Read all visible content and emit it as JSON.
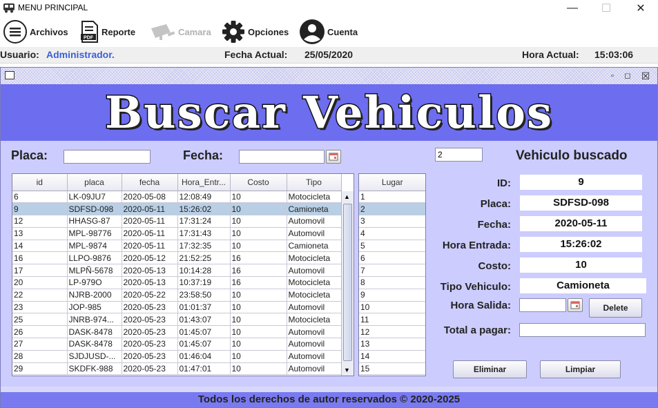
{
  "window": {
    "title": "MENU PRINCIPAL",
    "minimize": "—",
    "maximize": "☐",
    "close": "✕"
  },
  "toolbar": {
    "archivos": "Archivos",
    "reporte": "Reporte",
    "camara": "Camara",
    "opciones": "Opciones",
    "cuenta": "Cuenta"
  },
  "status": {
    "user_label": "Usuario:",
    "user_value": "Administrador.",
    "date_label": "Fecha Actual:",
    "date_value": "25/05/2020",
    "time_label": "Hora Actual:",
    "time_value": "15:03:06"
  },
  "frame": {
    "banner": "Buscar Vehiculos",
    "btn_iconify": "▫",
    "btn_max": "◻",
    "btn_close": "☒"
  },
  "search": {
    "placa_label": "Placa:",
    "placa_value": "",
    "fecha_label": "Fecha:",
    "fecha_value": "",
    "id_value": "2",
    "heading": "Vehiculo buscado"
  },
  "table": {
    "columns": [
      "id",
      "placa",
      "fecha",
      "Hora_Entr...",
      "Costo",
      "Tipo"
    ],
    "rows": [
      [
        "6",
        "LK-09JU7",
        "2020-05-08",
        "12:08:49",
        "10",
        "Motocicleta"
      ],
      [
        "9",
        "SDFSD-098",
        "2020-05-11",
        "15:26:02",
        "10",
        "Camioneta"
      ],
      [
        "12",
        "HHASG-87",
        "2020-05-11",
        "17:31:24",
        "10",
        "Automovil"
      ],
      [
        "13",
        "MPL-98776",
        "2020-05-11",
        "17:31:43",
        "10",
        "Automovil"
      ],
      [
        "14",
        "MPL-9874",
        "2020-05-11",
        "17:32:35",
        "10",
        "Camioneta"
      ],
      [
        "16",
        "LLPO-9876",
        "2020-05-12",
        "21:52:25",
        "16",
        "Motocicleta"
      ],
      [
        "17",
        "MLPÑ-5678",
        "2020-05-13",
        "10:14:28",
        "16",
        "Automovil"
      ],
      [
        "20",
        "LP-979O",
        "2020-05-13",
        "10:37:19",
        "16",
        "Motocicleta"
      ],
      [
        "22",
        "NJRB-2000",
        "2020-05-22",
        "23:58:50",
        "10",
        "Motocicleta"
      ],
      [
        "23",
        "JOP-985",
        "2020-05-23",
        "01:01:37",
        "10",
        "Automovil"
      ],
      [
        "25",
        "JNRB-974...",
        "2020-05-23",
        "01:43:07",
        "10",
        "Motocicleta"
      ],
      [
        "26",
        "DASK-8478",
        "2020-05-23",
        "01:45:07",
        "10",
        "Automovil"
      ],
      [
        "27",
        "DASK-8478",
        "2020-05-23",
        "01:45:07",
        "10",
        "Automovil"
      ],
      [
        "28",
        "SJDJUSD-...",
        "2020-05-23",
        "01:46:04",
        "10",
        "Automovil"
      ],
      [
        "29",
        "SKDFK-988",
        "2020-05-23",
        "01:47:01",
        "10",
        "Automovil"
      ]
    ],
    "selected_row": 1
  },
  "lugar": {
    "header": "Lugar",
    "rows": [
      "1",
      "2",
      "3",
      "4",
      "5",
      "6",
      "7",
      "8",
      "9",
      "10",
      "11",
      "12",
      "13",
      "14",
      "15"
    ],
    "selected_row": 1
  },
  "details": {
    "id_label": "ID:",
    "id_value": "9",
    "placa_label": "Placa:",
    "placa_value": "SDFSD-098",
    "fecha_label": "Fecha:",
    "fecha_value": "2020-05-11",
    "hora_entrada_label": "Hora Entrada:",
    "hora_entrada_value": "15:26:02",
    "costo_label": "Costo:",
    "costo_value": "10",
    "tipo_label": "Tipo Vehiculo:",
    "tipo_value": "Camioneta",
    "hora_salida_label": "Hora Salida:",
    "hora_salida_value": "",
    "total_label": "Total a pagar:",
    "total_value": ""
  },
  "buttons": {
    "delete": "Delete",
    "eliminar": "Eliminar",
    "limpiar": "Limpiar"
  },
  "footer": "Todos los derechos de autor reservados © 2020-2025"
}
